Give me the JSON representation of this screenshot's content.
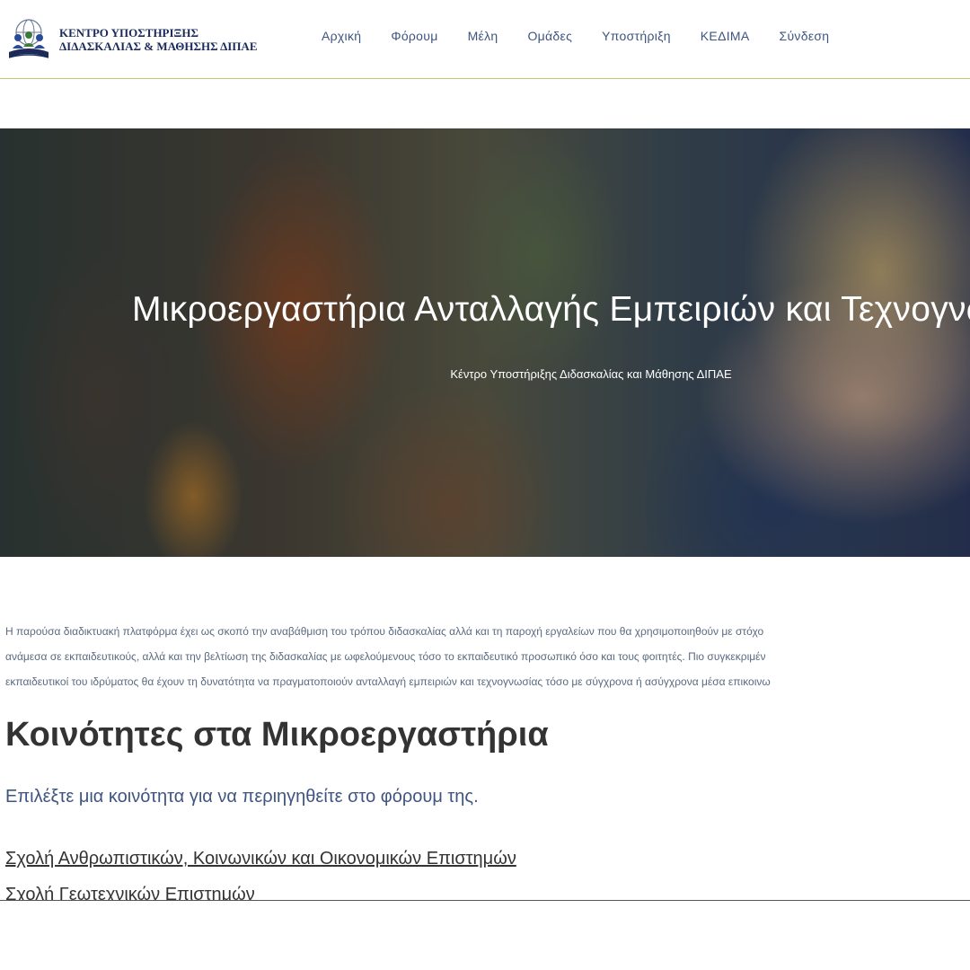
{
  "header": {
    "logo_line1": "ΚΕΝΤΡΟ ΥΠΟΣΤΗΡΙΞΗΣ",
    "logo_line2": "ΔΙΔΑΣΚΑΛΙΑΣ & ΜΑΘΗΣΗΣ ΔΙΠΑΕ",
    "nav": [
      {
        "label": "Αρχική"
      },
      {
        "label": "Φόρουμ"
      },
      {
        "label": "Μέλη"
      },
      {
        "label": "Ομάδες"
      },
      {
        "label": "Υποστήριξη"
      },
      {
        "label": "ΚΕΔΙΜΑ"
      },
      {
        "label": "Σύνδεση"
      }
    ],
    "border_color": "#b8cc7a",
    "nav_color": "#3d5580"
  },
  "hero": {
    "title": "Μικροεργαστήρια Ανταλλαγής Εμπειριών και Τεχνογνωσίας",
    "subtitle": "Κέντρο Υποστήριξης Διδασκαλίας και Μάθησης ΔΙΠΑΕ"
  },
  "intro": {
    "line1": "Η παρούσα διαδικτυακή πλατφόρμα έχει ως σκοπό την αναβάθμιση του τρόπου διδασκαλίας αλλά και τη παροχή εργαλείων που θα χρησιμοποιηθούν με στόχο",
    "line2": "ανάμεσα σε εκπαιδευτικούς, αλλά και την βελτίωση της διδασκαλίας με ωφελούμενους τόσο το εκπαιδευτικό προσωπικό όσο και τους φοιτητές. Πιο συγκεκριμέν",
    "line3": "εκπαιδευτικοί του ιδρύματος θα έχουν τη δυνατότητα να πραγματοποιούν ανταλλαγή εμπειριών και τεχνογνωσίας τόσο με σύγχρονα ή ασύγχρονα μέσα επικοινω"
  },
  "communities": {
    "title": "Κοινότητες στα Μικροεργαστήρια",
    "description": "Επιλέξτε μια κοινότητα για να περιηγηθείτε στο φόρουμ της.",
    "links": [
      {
        "label": "Σχολή Ανθρωπιστικών, Κοινωνικών και Οικονομικών Επιστημών"
      },
      {
        "label": "Σχολή Γεωτεχνικών Επιστημών"
      }
    ]
  }
}
